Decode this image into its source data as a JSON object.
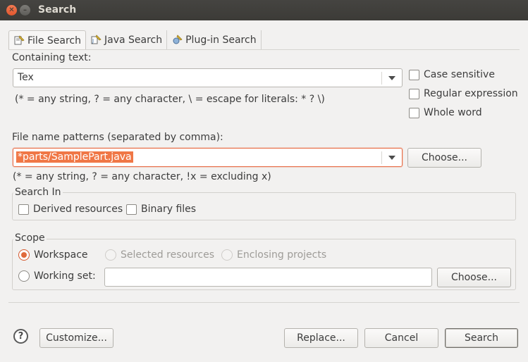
{
  "window": {
    "title": "Search"
  },
  "tabs": [
    {
      "label": "File Search",
      "icon": "file-search-icon",
      "active": true
    },
    {
      "label": "Java Search",
      "icon": "java-search-icon",
      "active": false
    },
    {
      "label": "Plug-in Search",
      "icon": "plugin-search-icon",
      "active": false
    }
  ],
  "containing": {
    "label": "Containing text:",
    "value": "Tex",
    "hint": "(* = any string, ? = any character, \\ = escape for literals: * ? \\)"
  },
  "options": {
    "case_sensitive": "Case sensitive",
    "regex": "Regular expression",
    "whole_word": "Whole word"
  },
  "patterns": {
    "label": "File name patterns (separated by comma):",
    "value": "*parts/SamplePart.java",
    "hint": "(* = any string, ? = any character, !x = excluding x)",
    "choose": "Choose..."
  },
  "search_in": {
    "title": "Search In",
    "derived": "Derived resources",
    "binary": "Binary files"
  },
  "scope": {
    "title": "Scope",
    "workspace": "Workspace",
    "selected": "Selected resources",
    "enclosing": "Enclosing projects",
    "working_set": "Working set:",
    "working_set_value": "",
    "choose": "Choose..."
  },
  "footer": {
    "help": "?",
    "customize": "Customize...",
    "replace": "Replace...",
    "cancel": "Cancel",
    "search": "Search"
  },
  "colors": {
    "accent": "#e8704a",
    "titlebar": "#3c3b37",
    "background": "#f2f1f0"
  }
}
